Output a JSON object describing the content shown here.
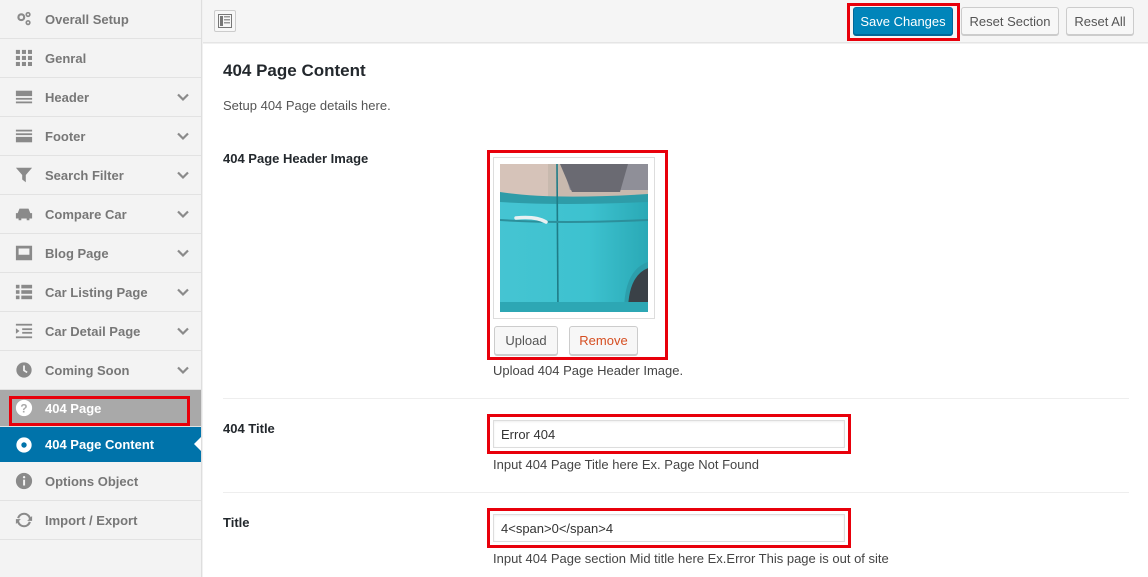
{
  "sidebar": {
    "items": [
      {
        "label": "Overall Setup",
        "icon": "gears-icon"
      },
      {
        "label": "Genral",
        "icon": "grid-icon"
      },
      {
        "label": "Header",
        "icon": "header-icon"
      },
      {
        "label": "Footer",
        "icon": "footer-icon"
      },
      {
        "label": "Search Filter",
        "icon": "filter-icon"
      },
      {
        "label": "Compare Car",
        "icon": "car-icon"
      },
      {
        "label": "Blog Page",
        "icon": "image-icon"
      },
      {
        "label": "Car Listing Page",
        "icon": "list-icon"
      },
      {
        "label": "Car Detail Page",
        "icon": "indent-icon"
      },
      {
        "label": "Coming Soon",
        "icon": "clock-icon"
      },
      {
        "label": "404 Page",
        "icon": "question-icon"
      },
      {
        "label": "404 Page Content",
        "icon": "gear-icon"
      },
      {
        "label": "Options Object",
        "icon": "info-icon"
      },
      {
        "label": "Import / Export",
        "icon": "refresh-icon"
      }
    ]
  },
  "toolbar": {
    "save_label": "Save Changes",
    "reset_section_label": "Reset Section",
    "reset_all_label": "Reset All"
  },
  "main": {
    "title": "404 Page Content",
    "description": "Setup 404 Page details here.",
    "fields": {
      "header_image": {
        "label": "404 Page Header Image",
        "upload_label": "Upload",
        "remove_label": "Remove",
        "description": "Upload 404 Page Header Image."
      },
      "title_404": {
        "label": "404 Title",
        "value": "Error 404",
        "description": "Input 404 Page Title here Ex. Page Not Found"
      },
      "title": {
        "label": "Title",
        "value": "4<span>0</span>4",
        "description": "Input 404 Page section Mid title here Ex.Error This page is out of site"
      }
    }
  },
  "colors": {
    "accent": "#0073aa",
    "primary_button": "#0085ba",
    "highlight": "#e8000b",
    "remove_text": "#d54e21"
  }
}
